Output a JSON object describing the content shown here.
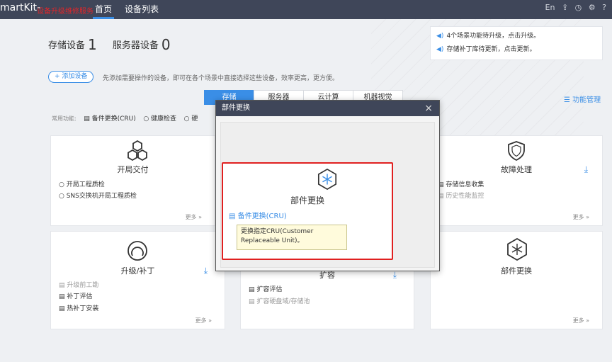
{
  "topbar": {
    "brand": "martKit-",
    "brand_sub": "设备升级维修服务",
    "tabs": [
      "首页",
      "设备列表"
    ],
    "lang": "En"
  },
  "counts": {
    "storage_label": "存储设备",
    "storage_value": "1",
    "server_label": "服务器设备",
    "server_value": "0"
  },
  "add_device": {
    "label": "+ 添加设备",
    "hint": "先添加需要操作的设备，即可在各个场景中直接选择这些设备，效率更高，更方便。"
  },
  "notices": [
    "4个场景功能待升级，点击升级。",
    "存储补丁库待更新，点击更新。"
  ],
  "scenario_tabs": [
    "存储",
    "服务器",
    "云计算",
    "机器视觉"
  ],
  "manage": "功能管理",
  "common": {
    "label": "常用功能:",
    "items": [
      "备件更换(CRU)",
      "健康检查",
      "硬"
    ]
  },
  "cards": {
    "deploy": {
      "title": "开局交付",
      "items": [
        "开局工程质检",
        "SNS交换机开局工程质检"
      ],
      "more": "更多 »"
    },
    "fault": {
      "title": "故障处理",
      "items": [
        "存储信息收集",
        "历史性能监控"
      ],
      "more": "更多 »"
    },
    "upgrade": {
      "title": "升级/补丁",
      "items": [
        "升级前工勘",
        "补丁评估",
        "热补丁安装"
      ],
      "more": "更多 »"
    },
    "expand": {
      "title": "扩容",
      "items": [
        "扩容评估",
        "扩容硬盘域/存储池"
      ]
    },
    "parts": {
      "title": "部件更换",
      "more": "更多 »"
    }
  },
  "dialog": {
    "title": "部件更换",
    "card_title": "部件更换",
    "link": "备件更换(CRU)",
    "tooltip": "更换指定CRU(Customer Replaceable Unit)。"
  },
  "colors": {
    "accent": "#3a8ee6",
    "topbar": "#3f4659",
    "highlight": "#e02020"
  }
}
